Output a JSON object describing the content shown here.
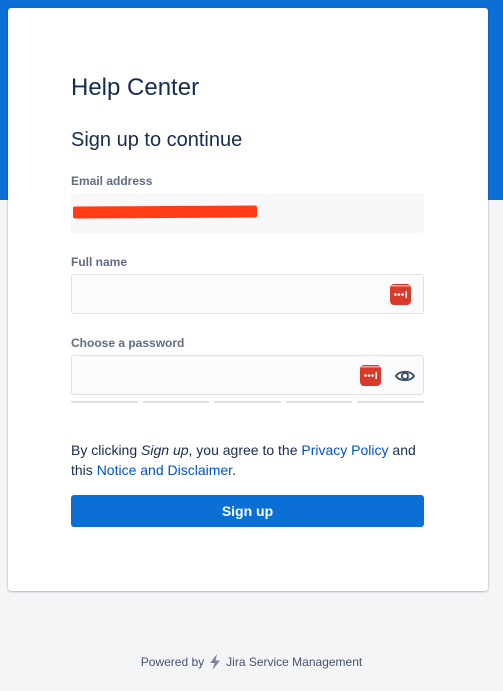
{
  "page": {
    "title": "Help Center",
    "subtitle": "Sign up to continue"
  },
  "form": {
    "email_label": "Email address",
    "full_name_label": "Full name",
    "full_name_value": "",
    "password_label": "Choose a password",
    "password_value": "",
    "password_strength_segments": 5
  },
  "legal": {
    "prefix": "By clicking ",
    "action": "Sign up",
    "middle": ", you agree to the ",
    "privacy_link": "Privacy Policy",
    "and": " and",
    "this": "this ",
    "notice_link": "Notice and Disclaimer",
    "suffix": "."
  },
  "signup_button": "Sign up",
  "footer": {
    "powered_by": "Powered by",
    "product": "Jira Service Management"
  },
  "colors": {
    "brand_blue": "#0c6fd6",
    "link": "#0052cc",
    "password_manager_icon": "#d93b2b",
    "redaction": "#ff3c16"
  },
  "icons": [
    "password-manager-icon",
    "eye-icon",
    "bolt-icon"
  ]
}
